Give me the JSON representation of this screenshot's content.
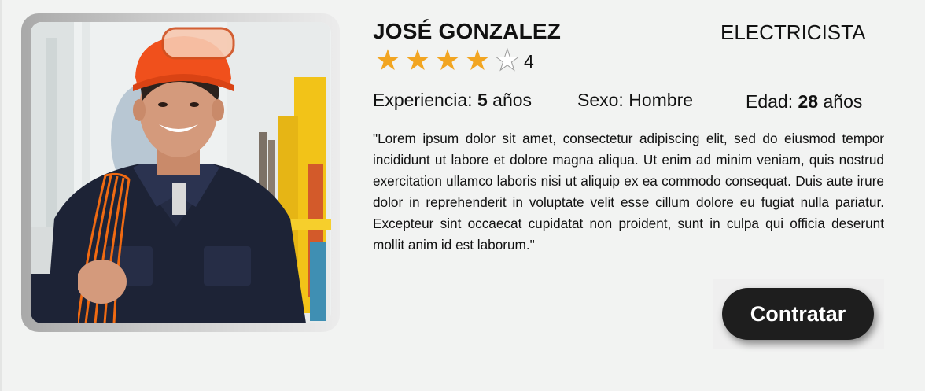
{
  "profile": {
    "name": "JOSÉ GONZALEZ",
    "profession": "ELECTRICISTA",
    "rating": {
      "value": "4",
      "stars_filled": 4,
      "stars_total": 5,
      "star_color": "#f2a521"
    },
    "experience": {
      "label": "Experiencia:",
      "value": "5",
      "unit": "años"
    },
    "sex": {
      "label": "Sexo:",
      "value": "Hombre"
    },
    "age": {
      "label": "Edad:",
      "value": "28",
      "unit": "años"
    },
    "description": "\"Lorem ipsum dolor sit amet, consectetur adipiscing elit, sed do eiusmod tempor incididunt ut labore et dolore magna aliqua. Ut enim ad minim veniam, quis nostrud exercitation ullamco laboris nisi ut aliquip ex ea commodo consequat. Duis aute irure dolor in reprehenderit in voluptate velit esse cillum dolore eu fugiat nulla pariatur. Excepteur sint occaecat cupidatat non proident, sunt in culpa qui officia deserunt mollit anim id est laborum.\"",
    "photo_icon": "worker-photo"
  },
  "actions": {
    "hire_label": "Contratar",
    "button_color": "#1e1e1e"
  }
}
